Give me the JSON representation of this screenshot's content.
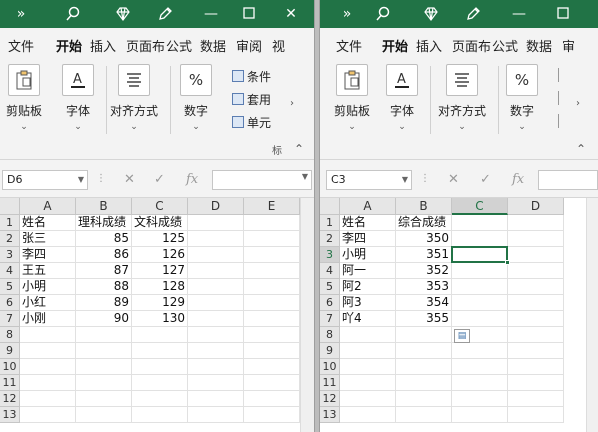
{
  "colors": {
    "title_bar": "#217346",
    "active_cell_border": "#217346",
    "grid_line": "#e1e1e1",
    "header_bg": "#e6e6e6"
  },
  "left": {
    "tabs": [
      "文件",
      "开始",
      "插入",
      "页面布",
      "公式",
      "数据",
      "审阅",
      "视"
    ],
    "active_tab": "开始",
    "ribbon": {
      "clipboard": "剪贴板",
      "font": "字体",
      "align": "对齐方式",
      "number": "数字",
      "number_symbol": "%",
      "styles": [
        "条件",
        "套用",
        "单元"
      ],
      "collapse_hint": "标"
    },
    "name_box": "D6",
    "columns": [
      "A",
      "B",
      "C",
      "D",
      "E"
    ],
    "rows": [
      "1",
      "2",
      "3",
      "4",
      "5",
      "6",
      "7",
      "8",
      "9",
      "10",
      "11",
      "12",
      "13"
    ],
    "cells": [
      [
        "姓名",
        "理科成绩",
        "文科成绩",
        "",
        ""
      ],
      [
        "张三",
        "85",
        "125",
        "",
        ""
      ],
      [
        "李四",
        "86",
        "126",
        "",
        ""
      ],
      [
        "王五",
        "87",
        "127",
        "",
        ""
      ],
      [
        "小明",
        "88",
        "128",
        "",
        ""
      ],
      [
        "小红",
        "89",
        "129",
        "",
        ""
      ],
      [
        "小刚",
        "90",
        "130",
        "",
        ""
      ]
    ]
  },
  "right": {
    "tabs": [
      "文件",
      "开始",
      "插入",
      "页面布",
      "公式",
      "数据",
      "审"
    ],
    "active_tab": "开始",
    "ribbon": {
      "clipboard": "剪贴板",
      "font": "字体",
      "align": "对齐方式",
      "number": "数字",
      "number_symbol": "%"
    },
    "name_box": "C3",
    "columns": [
      "A",
      "B",
      "C",
      "D"
    ],
    "selected_column": "C",
    "selected_row": "3",
    "rows": [
      "1",
      "2",
      "3",
      "4",
      "5",
      "6",
      "7",
      "8",
      "9",
      "10",
      "11",
      "12",
      "13"
    ],
    "cells": [
      [
        "姓名",
        "综合成绩",
        "",
        ""
      ],
      [
        "李四",
        "350",
        "",
        ""
      ],
      [
        "小明",
        "351",
        "",
        ""
      ],
      [
        "阿一",
        "352",
        "",
        ""
      ],
      [
        "阿2",
        "353",
        "",
        ""
      ],
      [
        "阿3",
        "354",
        "",
        ""
      ],
      [
        "吖4",
        "355",
        "",
        ""
      ]
    ]
  },
  "icons": {
    "fx": "fx",
    "cancel": "✕",
    "enter": "✓"
  }
}
